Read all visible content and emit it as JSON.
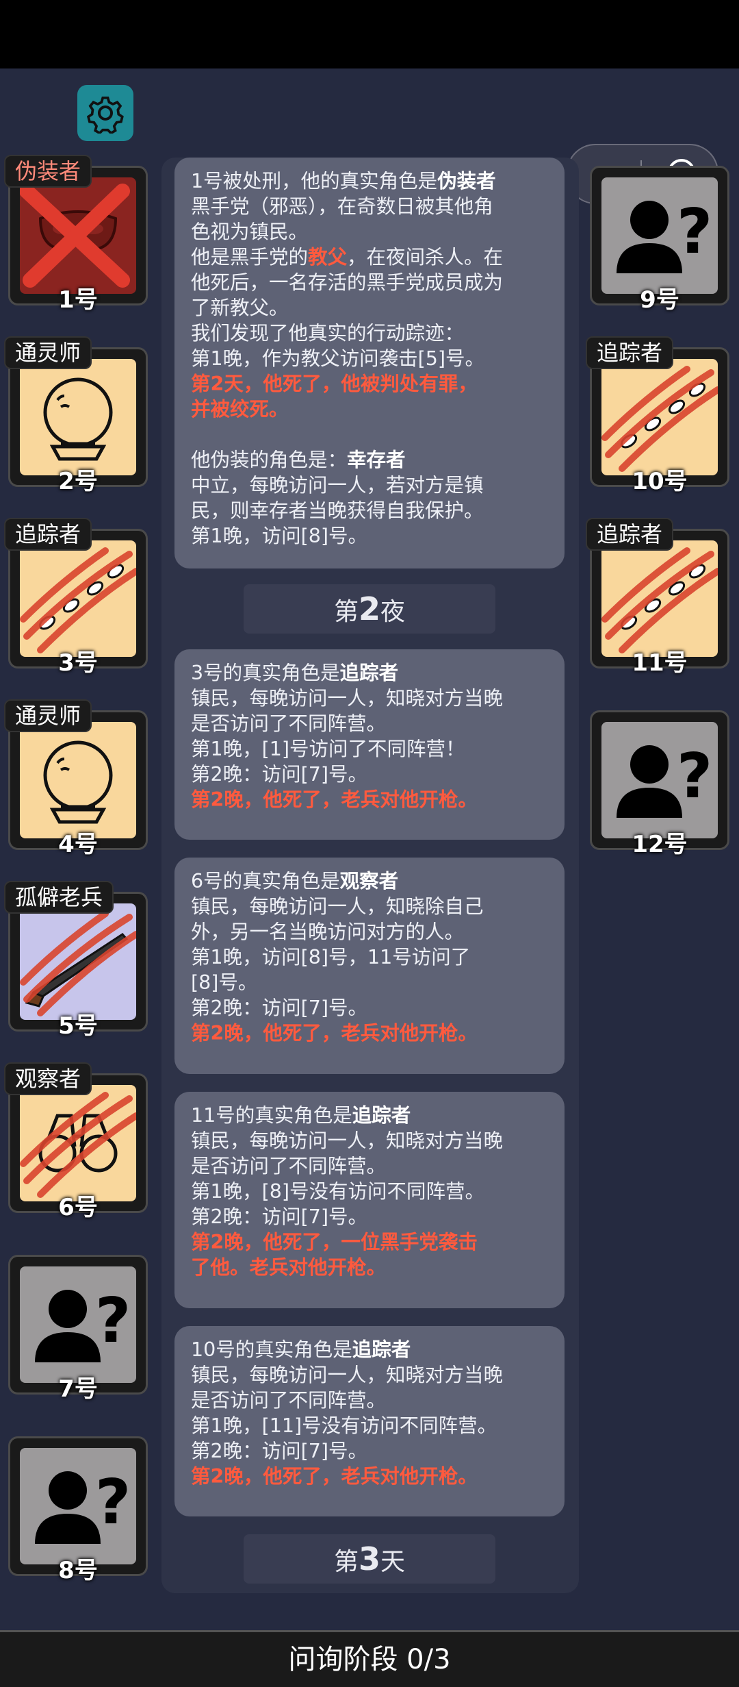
{
  "settings_icon": "gear-icon",
  "capsule": {
    "more_icon": "more-dots-icon",
    "close_icon": "target-icon"
  },
  "players": {
    "p1": {
      "number": "1号",
      "role": "伪装者"
    },
    "p2": {
      "number": "2号",
      "role": "通灵师"
    },
    "p3": {
      "number": "3号",
      "role": "追踪者"
    },
    "p4": {
      "number": "4号",
      "role": "通灵师"
    },
    "p5": {
      "number": "5号",
      "role": "孤僻老兵"
    },
    "p6": {
      "number": "6号",
      "role": "观察者"
    },
    "p7": {
      "number": "7号"
    },
    "p8": {
      "number": "8号"
    },
    "p9": {
      "number": "9号"
    },
    "p10": {
      "number": "10号",
      "role": "追踪者"
    },
    "p11": {
      "number": "11号",
      "role": "追踪者"
    },
    "p12": {
      "number": "12号"
    }
  },
  "log": {
    "m1": {
      "l1a": "1号被处刑，他的真实角色是",
      "l1b": "伪装者",
      "l2": "黑手党（邪恶），在奇数日被其他角",
      "l3": "色视为镇民。",
      "l4a": "他是黑手党的",
      "l4b": "教父",
      "l4c": "，在夜间杀人。在",
      "l5": "他死后，一名存活的黑手党成员成为",
      "l6": "了新教父。",
      "l7": "我们发现了他真实的行动踪迹：",
      "l8": "第1晚，作为教父访问袭击[5]号。",
      "l9": "第2天，他死了，他被判处有罪，",
      "l10": "并被绞死。",
      "l11a": "他伪装的角色是：",
      "l11b": "幸存者",
      "l12": "中立，每晚访问一人，若对方是镇",
      "l13": "民，则幸存者当晚获得自我保护。",
      "l14": "第1晚，访问[8]号。"
    },
    "night2": {
      "pre": "第",
      "num": "2",
      "post": "夜"
    },
    "m2": {
      "l1a": "3号的真实角色是",
      "l1b": "追踪者",
      "l2": "镇民，每晚访问一人，知晓对方当晚",
      "l3": "是否访问了不同阵营。",
      "l4": "第1晚，[1]号访问了不同阵营！",
      "l5": "第2晚：访问[7]号。",
      "l6": "第2晚，他死了，老兵对他开枪。"
    },
    "m3": {
      "l1a": "6号的真实角色是",
      "l1b": "观察者",
      "l2": "镇民，每晚访问一人，知晓除自己",
      "l3": "外，另一名当晚访问对方的人。",
      "l4": "第1晚，访问[8]号，11号访问了",
      "l5": "[8]号。",
      "l6": "第2晚：访问[7]号。",
      "l7": "第2晚，他死了，老兵对他开枪。"
    },
    "m4": {
      "l1a": "11号的真实角色是",
      "l1b": "追踪者",
      "l2": "镇民，每晚访问一人，知晓对方当晚",
      "l3": "是否访问了不同阵营。",
      "l4": "第1晚，[8]号没有访问不同阵营。",
      "l5": "第2晚：访问[7]号。",
      "l6": "第2晚，他死了，一位黑手党袭击",
      "l7": "了他。老兵对他开枪。"
    },
    "m5": {
      "l1a": "10号的真实角色是",
      "l1b": "追踪者",
      "l2": "镇民，每晚访问一人，知晓对方当晚",
      "l3": "是否访问了不同阵营。",
      "l4": "第1晚，[11]号没有访问不同阵营。",
      "l5": "第2晚：访问[7]号。",
      "l6": "第2晚，他死了，老兵对他开枪。"
    },
    "day3": {
      "pre": "第",
      "num": "3",
      "post": "天"
    }
  },
  "phase": "问询阶段 0/3",
  "colors": {
    "background": "#252a40",
    "accent_red": "#ff5a3e",
    "gear": "#1e8a95"
  }
}
